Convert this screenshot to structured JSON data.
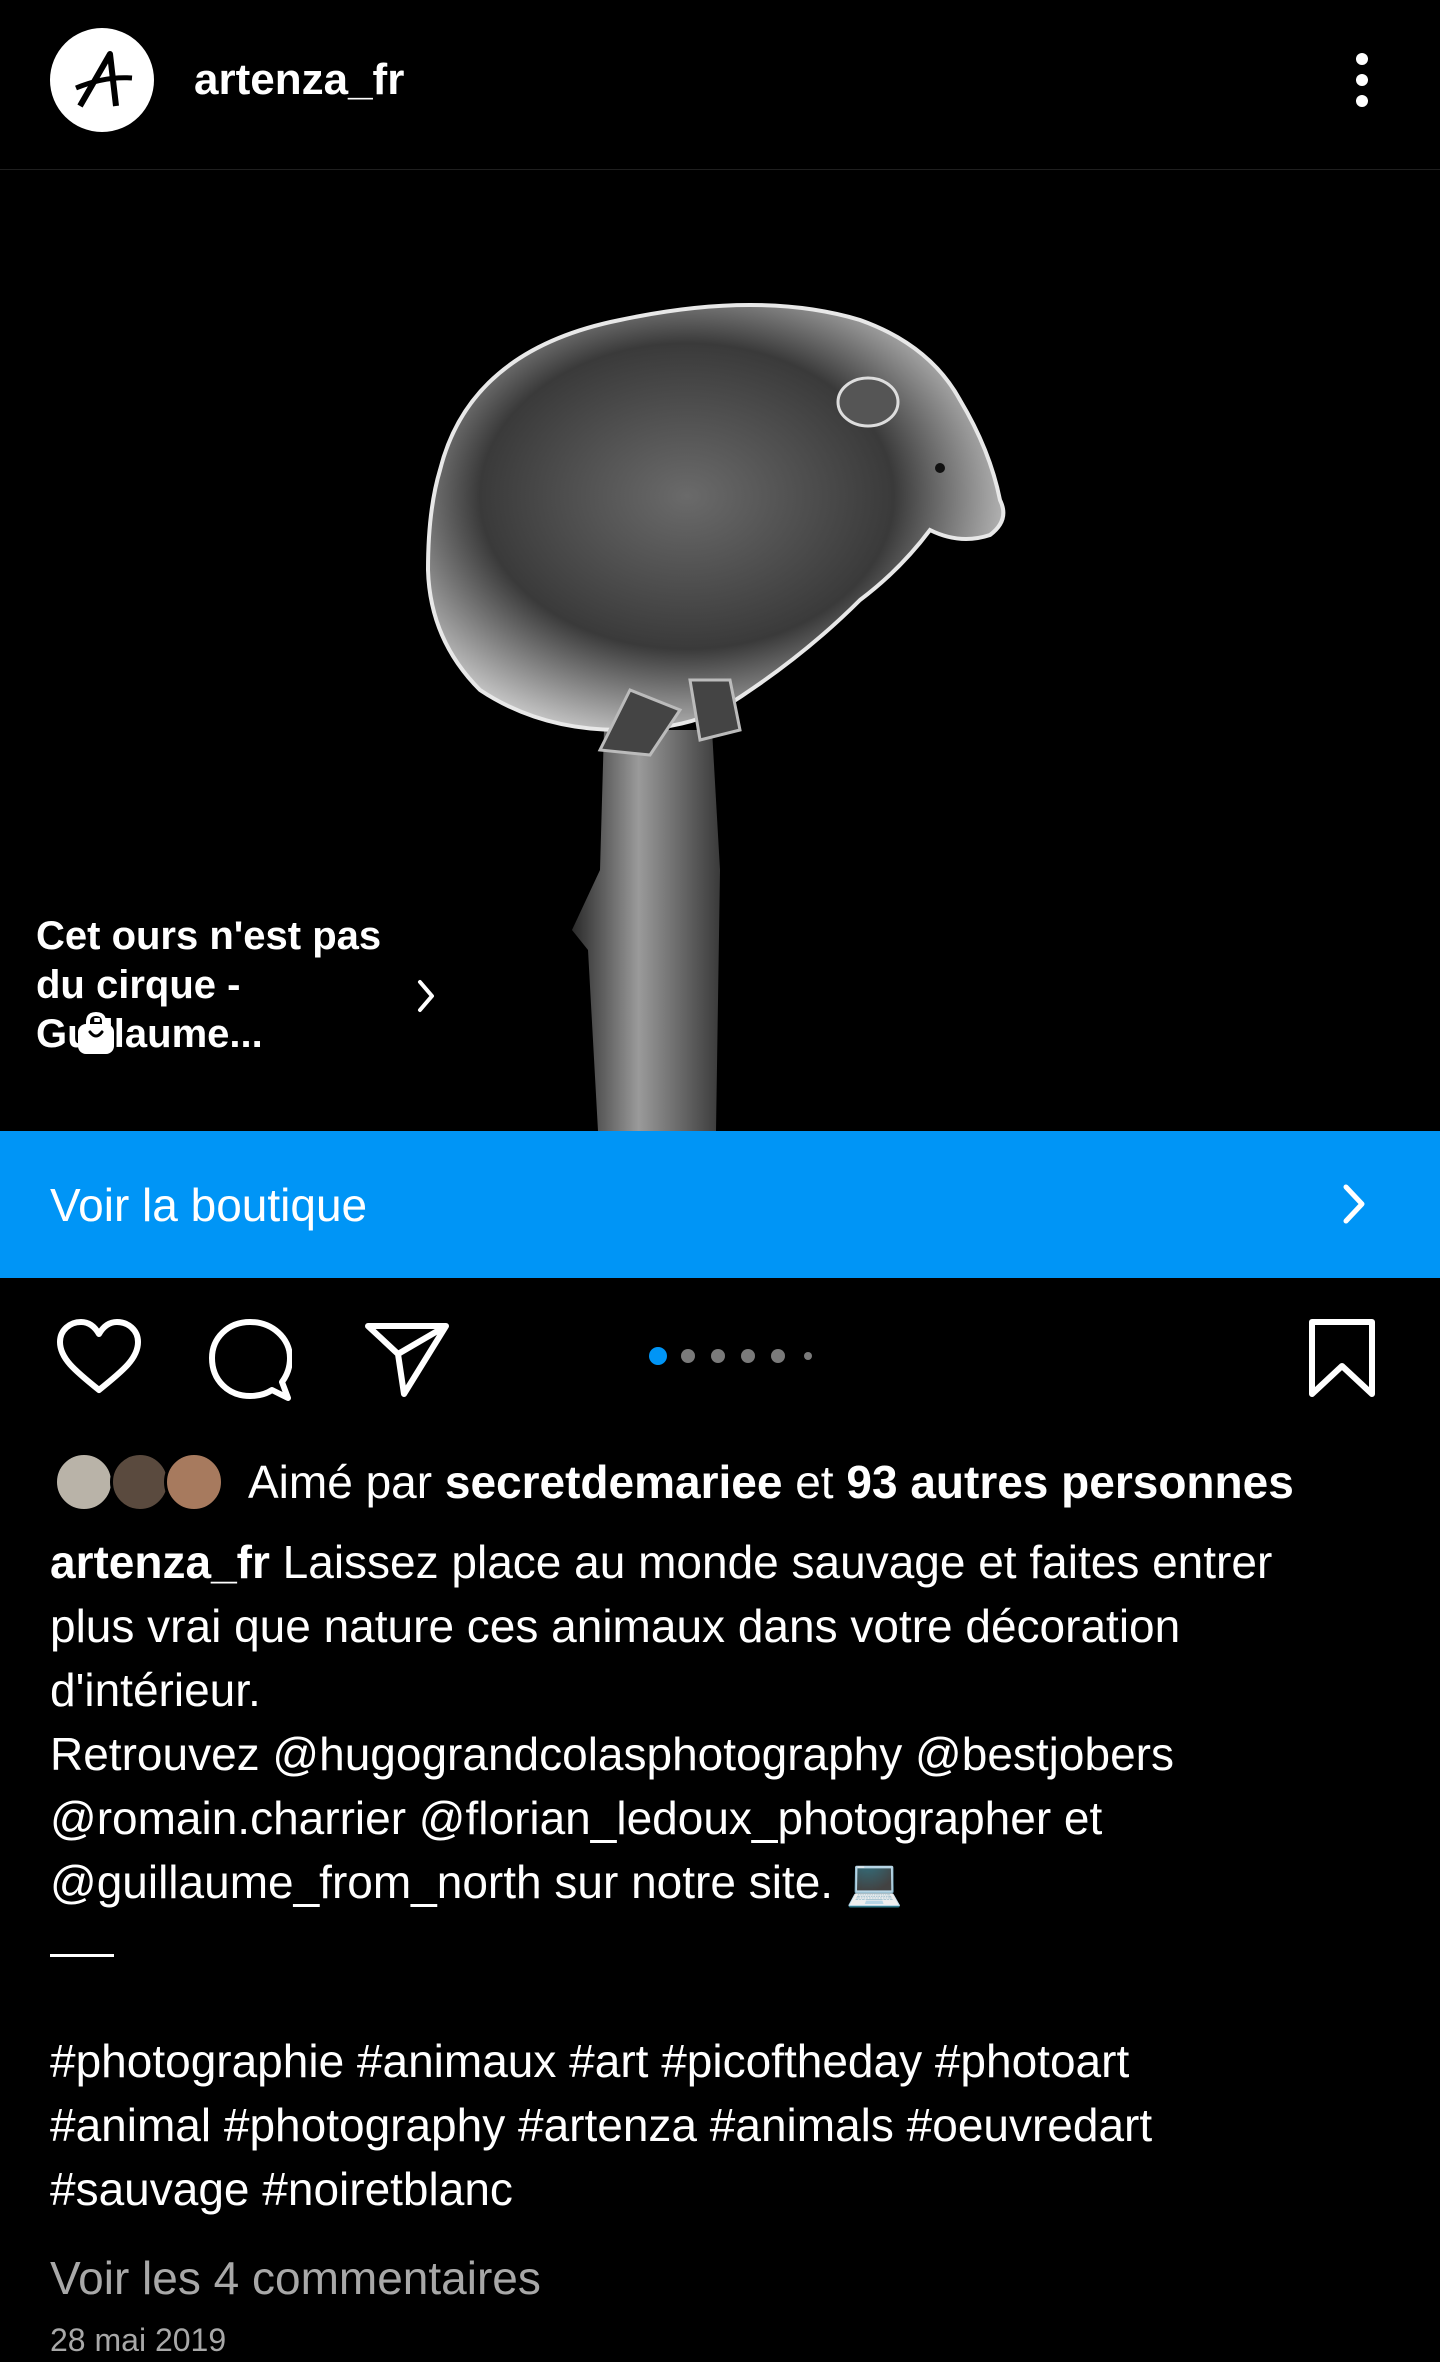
{
  "post": {
    "username": "artenza_fr",
    "product_tag": "Cet ours n'est pas du cirque - Guillaume...",
    "shop_label": "Voir la boutique",
    "carousel": {
      "current": 1,
      "total": 6
    },
    "likes": {
      "prefix": "Aimé par ",
      "user": "secretdemariee",
      "middle": " et ",
      "others": "93 autres personnes"
    },
    "caption": {
      "author": "artenza_fr",
      "line1": " Laissez place au monde sauvage et faites entrer",
      "line2": "plus vrai que nature ces animaux dans votre décoration",
      "line3": "d'intérieur.",
      "line4": "Retrouvez @hugograndcolasphotography @bestjobers",
      "line5": "@romain.charrier @florian_ledoux_photographer et",
      "line6": "@guillaume_from_north sur notre site. 💻",
      "hashtags1": "#photographie #animaux #art #picoftheday #photoart",
      "hashtags2": "#animal #photography #artenza #animals #oeuvredart",
      "hashtags3": "#sauvage #noiretblanc"
    },
    "view_comments": "Voir les 4 commentaires",
    "date": "28 mai 2019"
  },
  "colors": {
    "accent": "#0095f6",
    "background": "#000000",
    "muted": "#a8a8a8"
  },
  "icons": [
    "logo-a-icon",
    "more-vertical-icon",
    "chevron-right-icon",
    "shopping-bag-icon",
    "heart-icon",
    "comment-icon",
    "share-icon",
    "bookmark-icon",
    "laptop-emoji"
  ]
}
